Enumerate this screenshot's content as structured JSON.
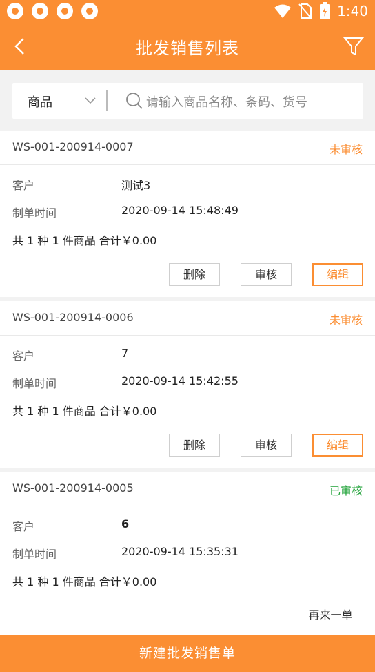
{
  "status_bar": {
    "time": "1:40"
  },
  "header": {
    "title": "批发销售列表"
  },
  "search": {
    "category": "商品",
    "placeholder": "请输入商品名称、条码、货号"
  },
  "orders": [
    {
      "order_no": "WS-001-200914-0007",
      "status": "未审核",
      "status_color": "#fb8e33",
      "customer_label": "客户",
      "customer": "测试3",
      "time_label": "制单时间",
      "time": "2020-09-14 15:48:49",
      "summary": "共 1 种 1 件商品 合计￥0.00",
      "buttons": [
        "删除",
        "审核",
        "编辑"
      ]
    },
    {
      "order_no": "WS-001-200914-0006",
      "status": "未审核",
      "status_color": "#fb8e33",
      "customer_label": "客户",
      "customer": "7",
      "time_label": "制单时间",
      "time": "2020-09-14 15:42:55",
      "summary": "共 1 种 1 件商品 合计￥0.00",
      "buttons": [
        "删除",
        "审核",
        "编辑"
      ]
    },
    {
      "order_no": "WS-001-200914-0005",
      "status": "已审核",
      "status_color": "#22a33a",
      "customer_label": "客户",
      "customer": "6",
      "time_label": "制单时间",
      "time": "2020-09-14 15:35:31",
      "summary": "共 1 种 1 件商品 合计￥0.00",
      "buttons": [
        "再来一单"
      ]
    }
  ],
  "footer": {
    "new_button": "新建批发销售单"
  },
  "colors": {
    "accent": "#fb8e33",
    "approved": "#22a33a"
  }
}
